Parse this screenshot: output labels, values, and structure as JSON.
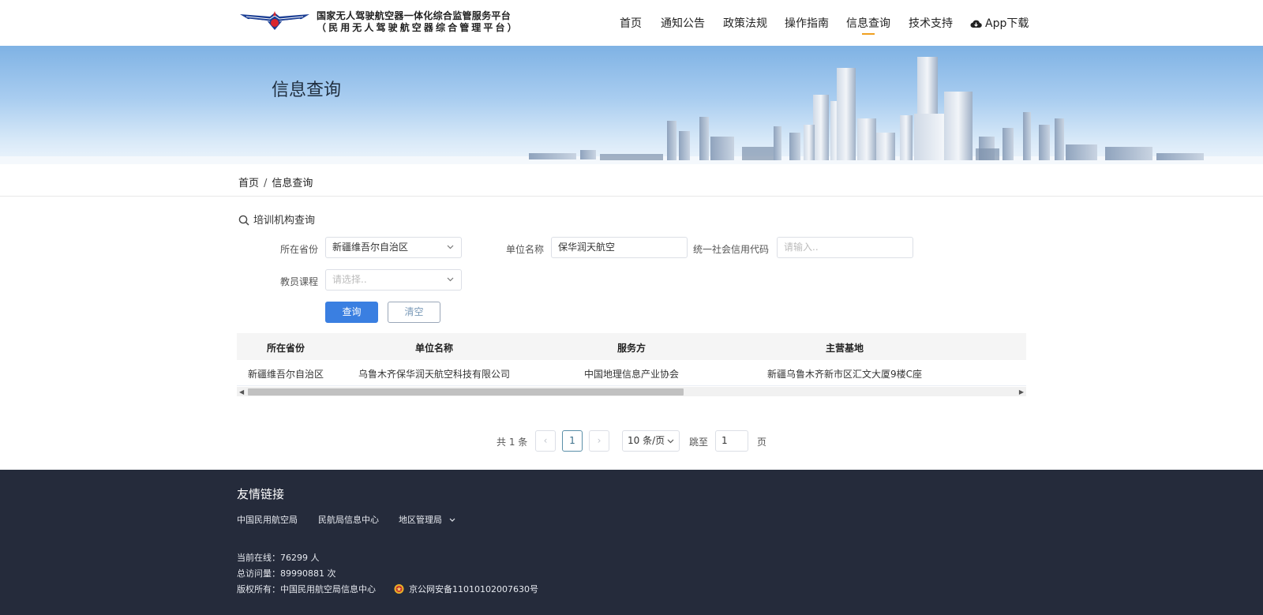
{
  "header": {
    "site_title": "国家无人驾驶航空器一体化综合监管服务平台",
    "site_subtitle": "（民用无人驾驶航空器综合管理平台）",
    "nav": [
      "首页",
      "通知公告",
      "政策法规",
      "操作指南",
      "信息查询",
      "技术支持"
    ],
    "active_nav": "信息查询",
    "app_download": "App下载",
    "accent_color": "#f0a020"
  },
  "banner": {
    "title": "信息查询"
  },
  "breadcrumb": {
    "home": "首页",
    "separator": "/",
    "current": "信息查询"
  },
  "search": {
    "section_title": "培训机构查询",
    "province_label": "所在省份",
    "province_value": "新疆维吾尔自治区",
    "org_label": "单位名称",
    "org_value": "保华润天航空",
    "credit_label": "统一社会信用代码",
    "credit_placeholder": "请输入..",
    "course_label": "教员课程",
    "course_placeholder": "请选择..",
    "query_button": "查询",
    "clear_button": "清空",
    "primary_color": "#3a7fe1"
  },
  "table": {
    "headers": [
      "所在省份",
      "单位名称",
      "服务方",
      "主营基地"
    ],
    "rows": [
      [
        "新疆维吾尔自治区",
        "乌鲁木齐保华润天航空科技有限公司",
        "中国地理信息产业协会",
        "新疆乌鲁木齐新市区汇文大厦9楼C座"
      ]
    ]
  },
  "pagination": {
    "total": "共 1 条",
    "prev": "‹",
    "current_page": "1",
    "next": "›",
    "page_size": "10 条/页",
    "jump_label": "跳至",
    "jump_value": "1",
    "page_unit": "页"
  },
  "footer": {
    "links_title": "友情链接",
    "links": [
      "中国民用航空局",
      "民航局信息中心",
      "地区管理局"
    ],
    "online": "当前在线：76299 人",
    "visits": "总访问量：89990881 次",
    "copyright": "版权所有：中国民用航空局信息中心",
    "icp": "京公网安备11010102007630号",
    "background_color": "#252b3b"
  }
}
